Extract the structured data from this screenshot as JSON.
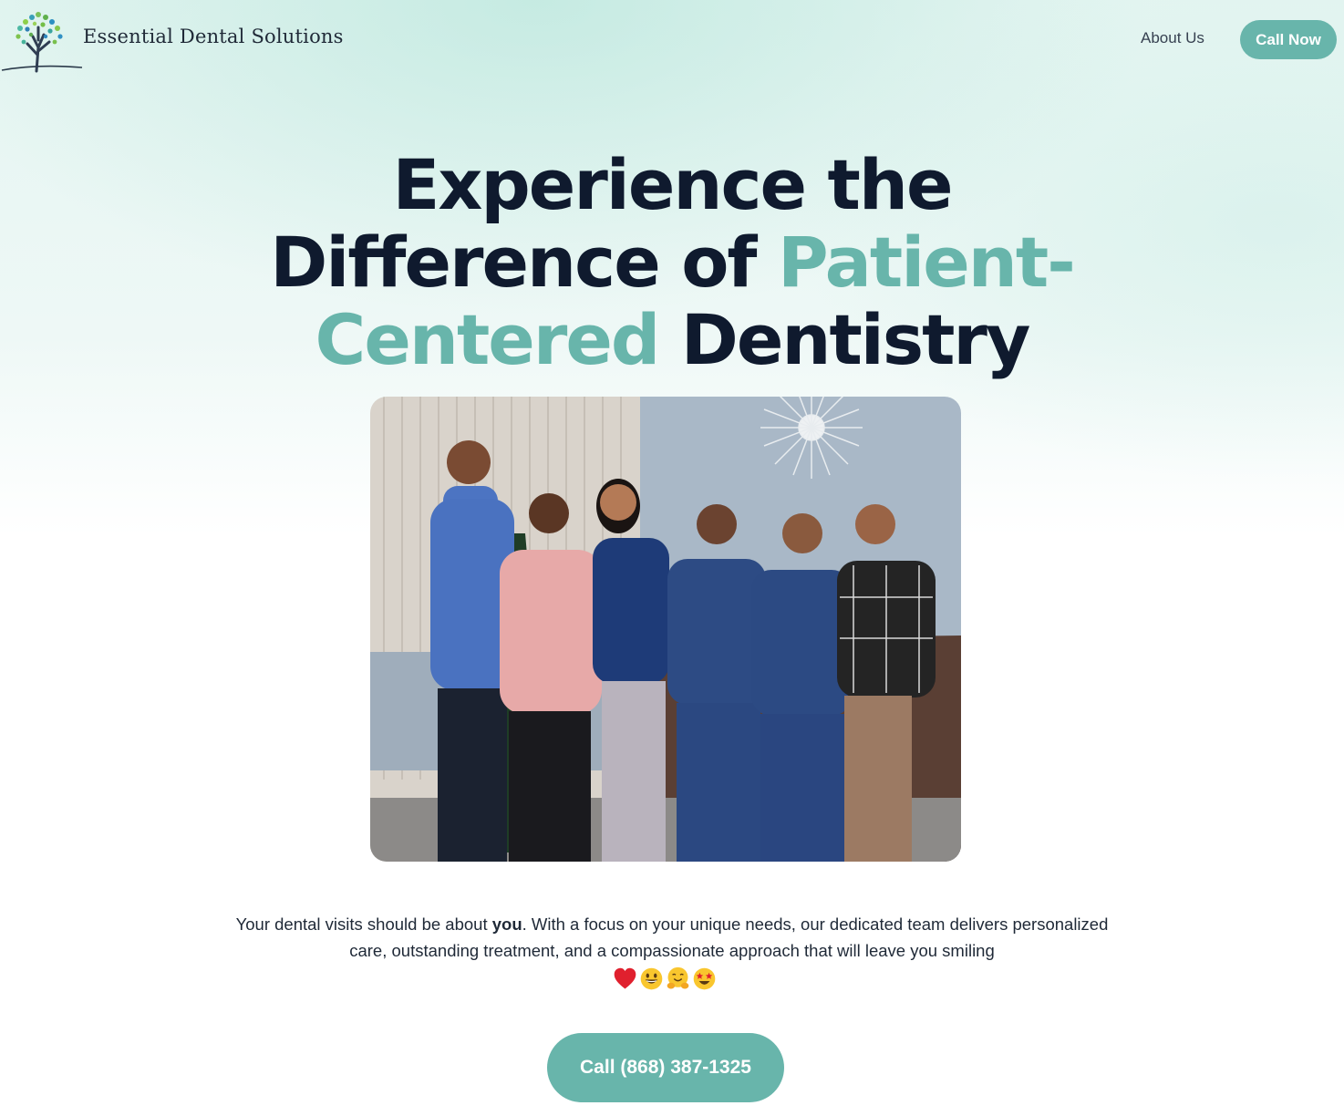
{
  "header": {
    "brand_name": "Essential Dental Solutions",
    "nav": {
      "about_label": "About Us",
      "call_now_label": "Call Now"
    }
  },
  "hero": {
    "headline_part1": "Experience the Difference of ",
    "headline_accent1": "Patient-",
    "headline_accent2": "Centered",
    "headline_part2": " Dentistry",
    "description_part1": "Your dental visits should be about ",
    "description_emphasis": "you",
    "description_part2": ". With a focus on your unique needs, our dedicated team delivers personalized care, outstanding treatment, and a compassionate approach that will leave you smiling",
    "emojis": [
      "red-heart-emoji",
      "grinning-face-emoji",
      "hugging-face-emoji",
      "star-struck-emoji"
    ],
    "cta_label": "Call (868) 387-1325"
  },
  "colors": {
    "accent": "#68b5ab",
    "heading": "#0f1a2e",
    "background_tint": "#e4f5f1"
  }
}
